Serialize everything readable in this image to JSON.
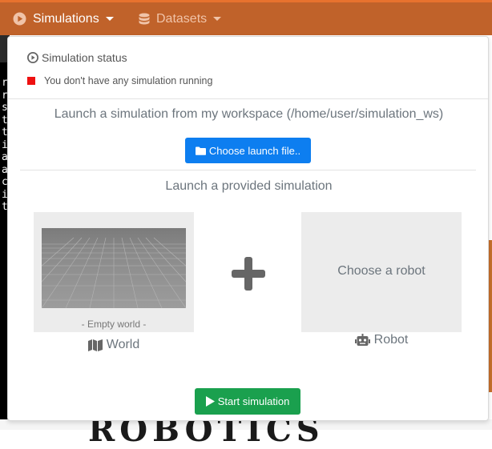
{
  "navbar": {
    "items": [
      {
        "label": "Simulations",
        "icon": "play-circle-icon"
      },
      {
        "label": "Datasets",
        "icon": "database-icon"
      }
    ]
  },
  "terminal": {
    "lines": [
      "r",
      "r",
      "s",
      "t",
      "t",
      "i",
      "a",
      "a",
      "c",
      "i",
      "t"
    ]
  },
  "panel": {
    "status": {
      "title": "Simulation status",
      "message": "You don't have any simulation running",
      "indicator_color": "#ee1111"
    },
    "workspace": {
      "heading": "Launch a simulation from my workspace (/home/user/simulation_ws)",
      "button_label": "Choose launch file.."
    },
    "provided": {
      "heading": "Launch a provided simulation",
      "world": {
        "caption": "- Empty world -",
        "label": "World"
      },
      "robot": {
        "placeholder": "Choose a robot",
        "label": "Robot"
      }
    },
    "start_button_label": "Start simulation"
  },
  "colors": {
    "navbar": "#c0622a",
    "primary": "#0d7ef0",
    "success": "#1aa04e"
  }
}
